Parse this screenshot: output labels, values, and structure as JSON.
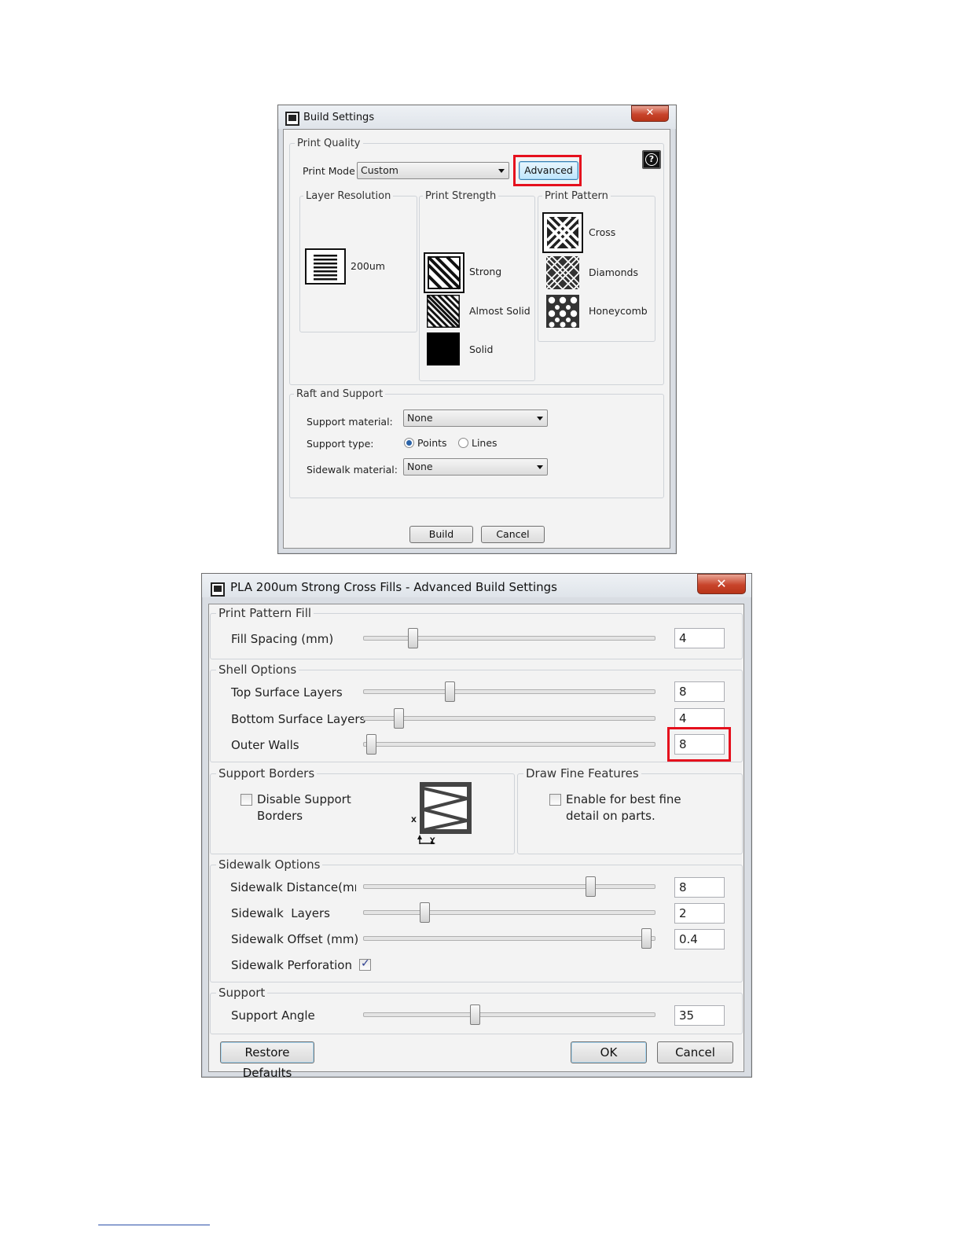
{
  "build_settings": {
    "title": "Build Settings",
    "print_quality": {
      "label": "Print Quality",
      "print_mode_label": "Print Mode",
      "print_mode_value": "Custom",
      "advanced_button": "Advanced",
      "help_icon": "question-mark-icon"
    },
    "layer_resolution": {
      "label": "Layer Resolution",
      "value": "200um"
    },
    "print_strength": {
      "label": "Print Strength",
      "options": [
        "Strong",
        "Almost Solid",
        "Solid"
      ],
      "selected": "Strong"
    },
    "print_pattern": {
      "label": "Print Pattern",
      "options": [
        "Cross",
        "Diamonds",
        "Honeycomb"
      ],
      "selected": "Cross"
    },
    "raft_support": {
      "label": "Raft and Support",
      "support_material_label": "Support material:",
      "support_material_value": "None",
      "support_type_label": "Support type:",
      "support_type_options": [
        "Points",
        "Lines"
      ],
      "support_type_selected": "Points",
      "sidewalk_material_label": "Sidewalk material:",
      "sidewalk_material_value": "None"
    },
    "buttons": {
      "build": "Build",
      "cancel": "Cancel"
    }
  },
  "advanced": {
    "title": "PLA 200um Strong Cross Fills - Advanced Build Settings",
    "print_pattern_fill": {
      "label": "Print Pattern Fill",
      "fill_spacing": {
        "label": "Fill Spacing (mm)",
        "value": "4",
        "level": 0.16
      }
    },
    "shell_options": {
      "label": "Shell Options",
      "top_surface_layers": {
        "label": "Top Surface Layers",
        "value": "8",
        "level": 0.29
      },
      "bottom_surface_layers": {
        "label": "Bottom Surface Layers",
        "value": "4",
        "level": 0.11
      },
      "outer_walls": {
        "label": "Outer Walls",
        "value": "8",
        "level": 0.01
      }
    },
    "support_borders": {
      "label": "Support Borders",
      "checkbox_label_line1": "Disable Support",
      "checkbox_label_line2": "Borders",
      "checked": false,
      "axis_x": "X",
      "axis_y": "Y"
    },
    "draw_fine_features": {
      "label": "Draw Fine Features",
      "checkbox_label_line1": "Enable for best fine",
      "checkbox_label_line2": "detail on parts.",
      "checked": false
    },
    "sidewalk_options": {
      "label": "Sidewalk Options",
      "distance": {
        "label": "Sidewalk Distance(mm)",
        "value": "8",
        "level": 0.79
      },
      "layers": {
        "label": "Sidewalk  Layers",
        "value": "2",
        "level": 0.2
      },
      "offset": {
        "label": "Sidewalk Offset (mm)",
        "value": "0.4",
        "level": 0.99
      },
      "perforation": {
        "label": "Sidewalk Perforation",
        "checked": true
      }
    },
    "support": {
      "label": "Support",
      "support_angle": {
        "label": "Support Angle",
        "value": "35",
        "level": 0.38
      }
    },
    "buttons": {
      "restore_defaults": "Restore Defaults",
      "ok": "OK",
      "cancel": "Cancel"
    }
  },
  "colors": {
    "highlight": "#e5101d",
    "accent": "#3c7fb1"
  }
}
